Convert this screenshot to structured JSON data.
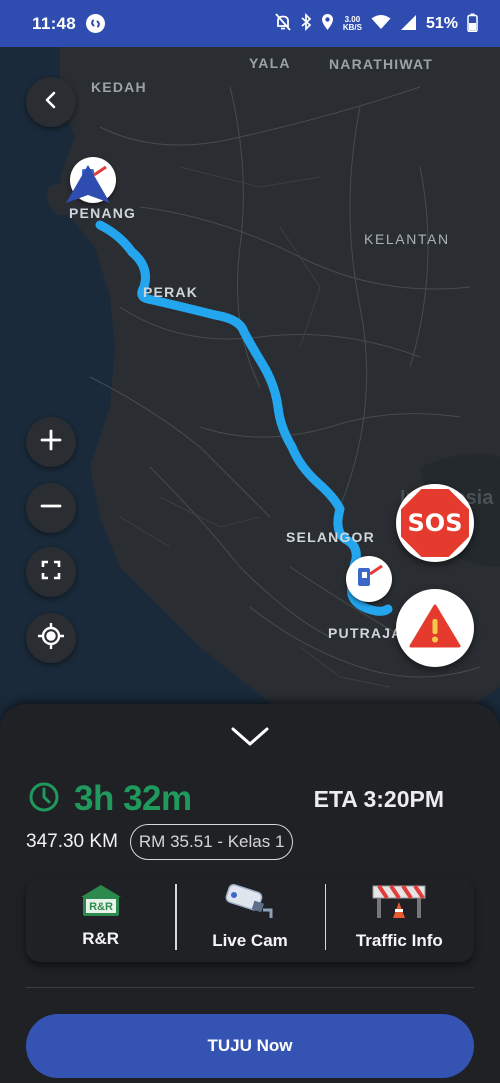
{
  "status_bar": {
    "time": "11:48",
    "net_speed_value": "3.00",
    "net_speed_unit": "KB/S",
    "battery": "51%",
    "icons": [
      "shazam-icon",
      "mute-icon",
      "bluetooth-icon",
      "location-icon",
      "wifi-icon",
      "signal-icon",
      "battery-icon"
    ]
  },
  "map": {
    "labels": {
      "yala": "YALA",
      "narathiwat": "NARATHIWAT",
      "kedah": "KEDAH",
      "penang": "PENANG",
      "kelantan": "KELANTAN",
      "perak": "PERAK",
      "selangor": "SELANGOR",
      "putrajaya": "PUTRAJAYA",
      "indonesia_partial": "Indonesia"
    },
    "route_color": "#24a6ee",
    "sos_label": "SOS"
  },
  "trip": {
    "duration": "3h 32m",
    "eta": "ETA 3:20PM",
    "distance": "347.30 KM",
    "toll": "RM 35.51 - Kelas 1",
    "duration_color": "#1f9a5c"
  },
  "features": [
    {
      "label": "R&R",
      "icon": "rest-area-icon",
      "badge": "R&R"
    },
    {
      "label": "Live Cam",
      "icon": "cctv-camera-icon"
    },
    {
      "label": "Traffic Info",
      "icon": "road-barrier-icon"
    }
  ],
  "cta": {
    "label": "TUJU Now"
  }
}
